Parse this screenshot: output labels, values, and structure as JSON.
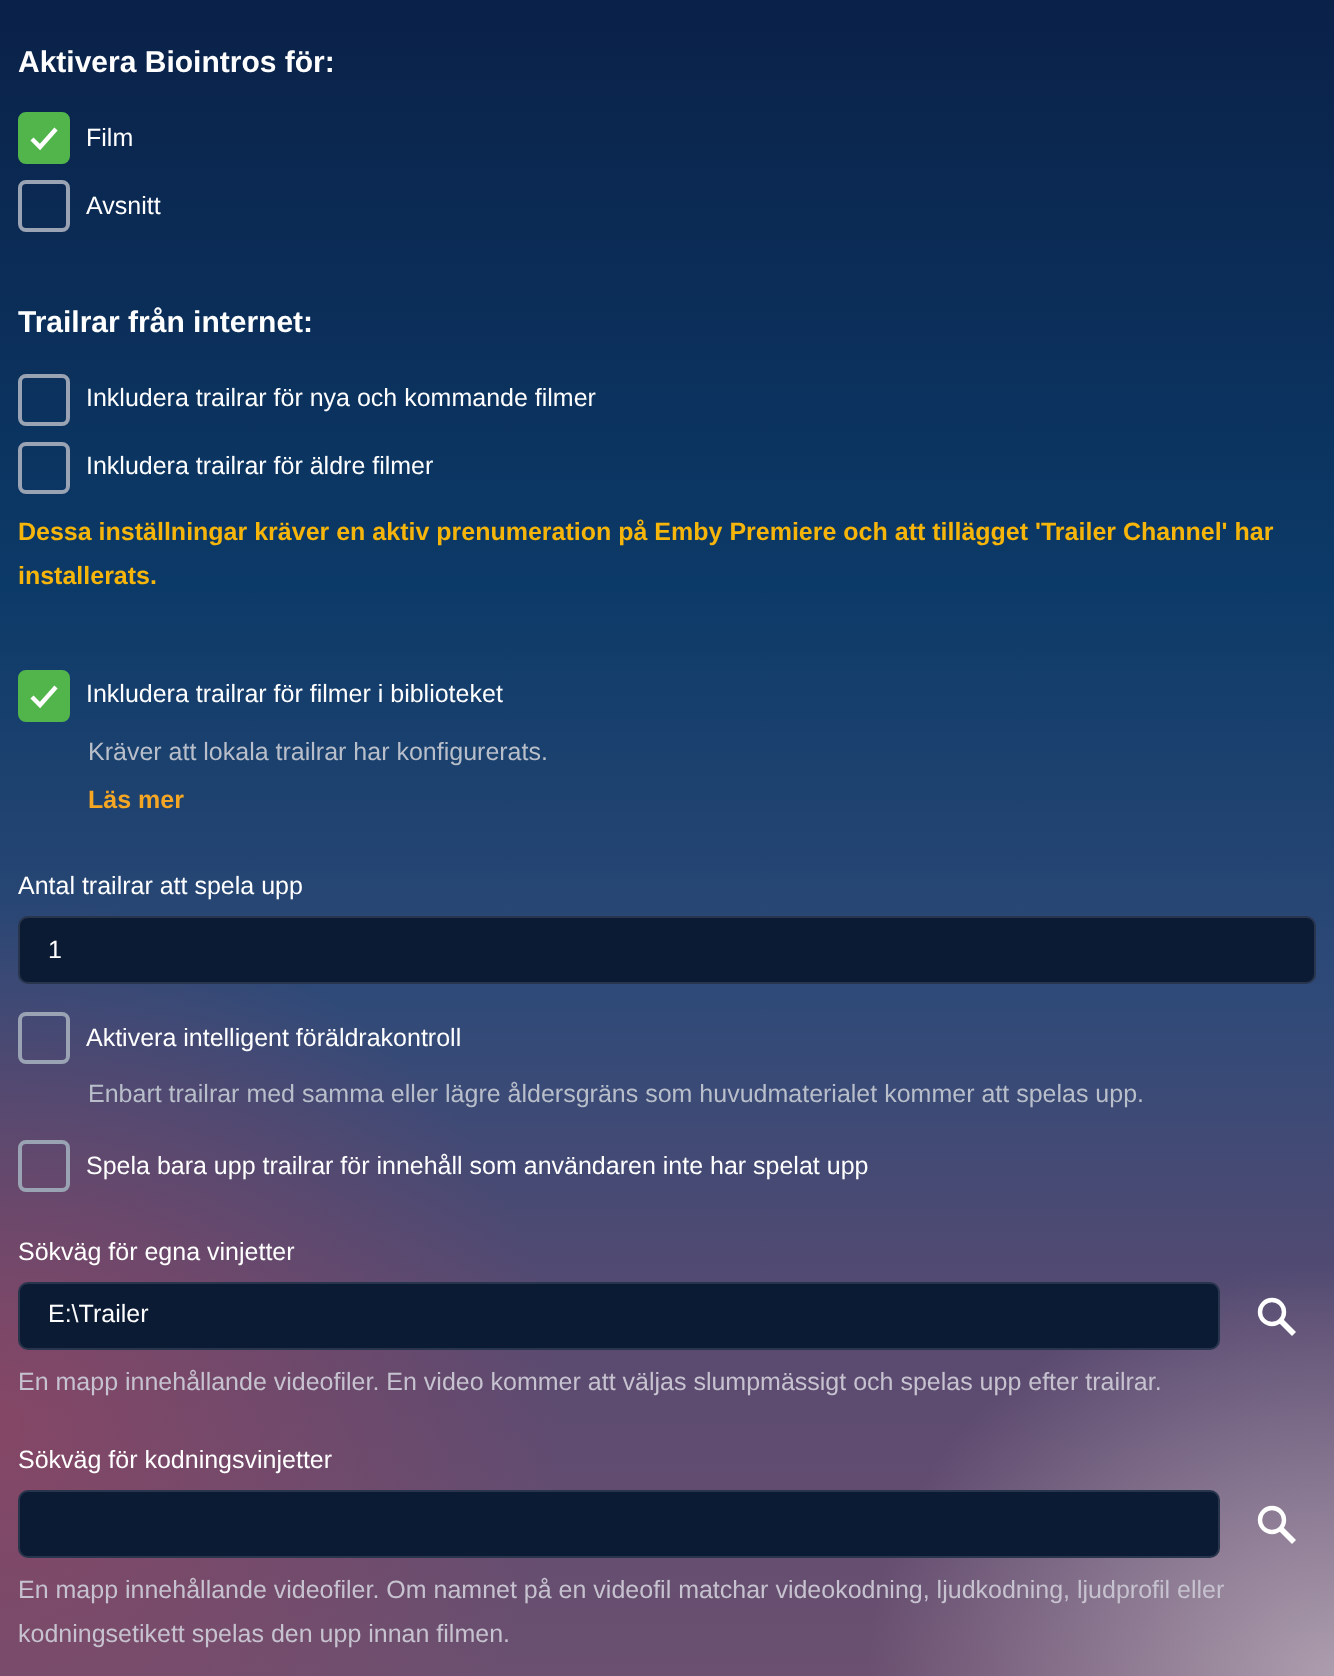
{
  "items": [
    {
      "kind": "heading",
      "text": "Aktivera Biointros för:"
    },
    {
      "kind": "checkbox",
      "label": "Film",
      "checked": true
    },
    {
      "kind": "checkbox",
      "label": "Avsnitt",
      "checked": false
    },
    {
      "kind": "heading",
      "text": "Trailrar från internet:"
    },
    {
      "kind": "checkbox",
      "label": "Inkludera trailrar för nya och kommande filmer",
      "checked": false
    },
    {
      "kind": "checkbox",
      "label": "Inkludera trailrar för äldre filmer",
      "checked": false
    },
    {
      "kind": "warning",
      "text": "Dessa inställningar kräver en aktiv prenumeration på Emby Premiere och att tillägget 'Trailer Channel' har installerats."
    },
    {
      "kind": "checkbox",
      "label": "Inkludera trailrar för filmer i biblioteket",
      "checked": true,
      "description": "Kräver att lokala trailrar har konfigurerats.",
      "link": "Läs mer"
    },
    {
      "kind": "input",
      "label": "Antal trailrar att spela upp",
      "value": "1"
    },
    {
      "kind": "checkbox",
      "label": "Aktivera intelligent föräldrakontroll",
      "checked": false,
      "description": "Enbart trailrar med samma eller lägre åldersgräns som huvudmaterialet kommer att spelas upp."
    },
    {
      "kind": "checkbox",
      "label": "Spela bara upp trailrar för innehåll som användaren inte har spelat upp",
      "checked": false
    },
    {
      "kind": "path",
      "label": "Sökväg för egna vinjetter",
      "value": "E:\\Trailer",
      "hint": "En mapp innehållande videofiler. En video kommer att väljas slumpmässigt och spelas upp efter trailrar."
    },
    {
      "kind": "path",
      "label": "Sökväg för kodningsvinjetter",
      "hint": "En mapp innehållande videofiler. Om namnet på en videofil matchar videokodning, ljudkodning, ljudprofil eller kodningsetikett spelas den upp innan filmen."
    }
  ]
}
